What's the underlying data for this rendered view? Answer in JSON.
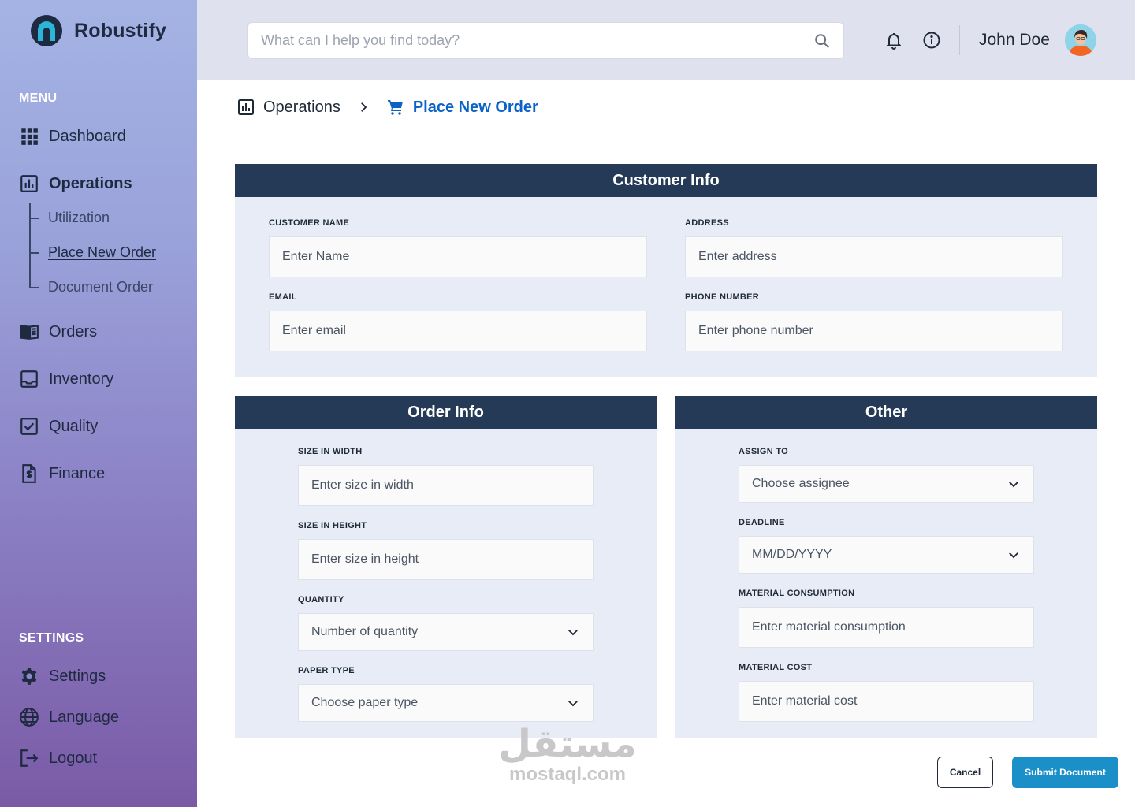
{
  "brand": {
    "name": "Robustify"
  },
  "sidebar": {
    "menu_label": "MENU",
    "settings_label": "SETTINGS",
    "items": [
      {
        "label": "Dashboard",
        "icon": "grid-icon"
      },
      {
        "label": "Operations",
        "icon": "chart-icon",
        "active": true
      },
      {
        "label": "Orders",
        "icon": "book-icon"
      },
      {
        "label": "Inventory",
        "icon": "inbox-icon"
      },
      {
        "label": "Quality",
        "icon": "checkbox-icon"
      },
      {
        "label": "Finance",
        "icon": "invoice-icon"
      }
    ],
    "sub_items": [
      {
        "label": "Utilization"
      },
      {
        "label": "Place New Order",
        "current": true
      },
      {
        "label": "Document Order"
      }
    ],
    "settings_items": [
      {
        "label": "Settings",
        "icon": "gear-icon"
      },
      {
        "label": "Language",
        "icon": "globe-icon"
      },
      {
        "label": "Logout",
        "icon": "logout-icon"
      }
    ]
  },
  "header": {
    "search_placeholder": "What can I help you find today?",
    "user_name": "John Doe"
  },
  "breadcrumb": {
    "parent": "Operations",
    "current": "Place New Order"
  },
  "customer_info": {
    "title": "Customer Info",
    "name_label": "CUSTOMER NAME",
    "name_placeholder": "Enter Name",
    "address_label": "ADDRESS",
    "address_placeholder": "Enter address",
    "email_label": "EMAIL",
    "email_placeholder": "Enter email",
    "phone_label": "PHONE NUMBER",
    "phone_placeholder": "Enter phone number"
  },
  "order_info": {
    "title": "Order Info",
    "width_label": "SIZE IN WIDTH",
    "width_placeholder": "Enter size in width",
    "height_label": "SIZE IN HEIGHT",
    "height_placeholder": "Enter size in height",
    "quantity_label": "QUANTITY",
    "quantity_placeholder": "Number of quantity",
    "paper_label": "PAPER TYPE",
    "paper_placeholder": "Choose paper type"
  },
  "other": {
    "title": "Other",
    "assign_label": "ASSIGN TO",
    "assign_placeholder": "Choose assignee",
    "deadline_label": "DEADLINE",
    "deadline_placeholder": "MM/DD/YYYY",
    "consumption_label": "MATERIAL CONSUMPTION",
    "consumption_placeholder": "Enter material consumption",
    "cost_label": "MATERIAL COST",
    "cost_placeholder": "Enter material cost"
  },
  "actions": {
    "cancel": "Cancel",
    "submit": "Submit Document"
  },
  "watermark": {
    "arabic": "مستقل",
    "latin": "mostaql.com"
  },
  "colors": {
    "header_panel": "#243a56",
    "panel_bg": "#e7ecf7",
    "accent_blue": "#0b63c5",
    "submit": "#1a8fc8"
  }
}
